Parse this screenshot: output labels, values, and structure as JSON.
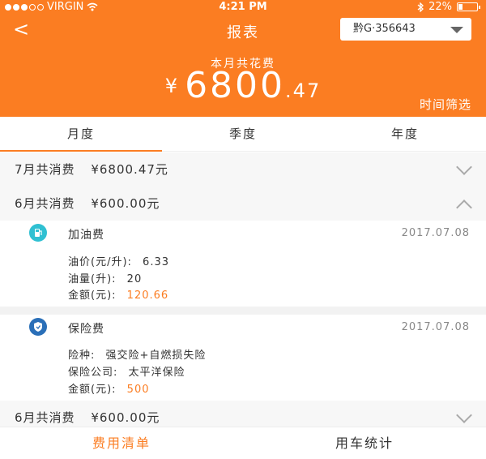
{
  "status_bar": {
    "carrier": "VIRGIN",
    "time": "4:21 PM",
    "battery": "22%"
  },
  "header": {
    "back_label": "<",
    "title": "报表",
    "plate": "黔G·356643",
    "total_label": "本月共花费",
    "total_currency": "¥",
    "total_integer": "6800",
    "total_decimal": ".47",
    "filter_label": "时间筛选"
  },
  "tabs": [
    "月度",
    "季度",
    "年度"
  ],
  "groups": [
    {
      "label": "7月共消费",
      "amount": "¥6800.47元",
      "expanded": false
    },
    {
      "label": "6月共消费",
      "amount": "¥600.00元",
      "expanded": true
    },
    {
      "label": "6月共消费",
      "amount": "¥600.00元",
      "expanded": false
    }
  ],
  "items": [
    {
      "icon": "fuel-pump-icon",
      "icon_color": "#2fc0d2",
      "name": "加油费",
      "date": "2017.07.08",
      "lines": [
        {
          "label": "油价(元/升):",
          "value": "6.33",
          "orange": false
        },
        {
          "label": "油量(升):",
          "value": "20",
          "orange": false
        },
        {
          "label": "金额(元):",
          "value": "120.66",
          "orange": true
        }
      ]
    },
    {
      "icon": "shield-icon",
      "icon_color": "#2a6fb8",
      "name": "保险费",
      "date": "2017.07.08",
      "lines": [
        {
          "label": "险种:",
          "value": "强交险+自燃损失险",
          "orange": false
        },
        {
          "label": "保险公司:",
          "value": "太平洋保险",
          "orange": false
        },
        {
          "label": "金额(元):",
          "value": "500",
          "orange": true
        }
      ]
    }
  ],
  "bottom_nav": [
    "费用清单",
    "用车统计"
  ],
  "colors": {
    "accent": "#fb7d22",
    "fuel_icon": "#2fc0d2",
    "insurance_icon": "#2a6fb8"
  }
}
